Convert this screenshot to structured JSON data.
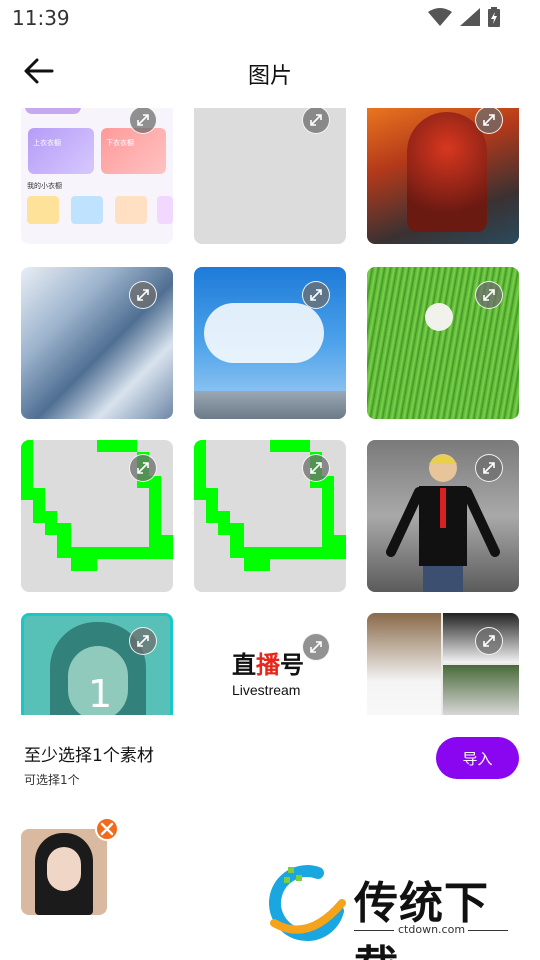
{
  "status": {
    "time": "11:39"
  },
  "header": {
    "title": "图片"
  },
  "grid": {
    "tiles": [
      {
        "name": "tile-app-screenshot",
        "overlay_text": "",
        "top_tag_a": "上衣衣橱",
        "top_tag_b": "下衣衣橱",
        "section": "我的小衣橱"
      },
      {
        "name": "tile-blank",
        "overlay_text": ""
      },
      {
        "name": "tile-armored-soldier",
        "overlay_text": ""
      },
      {
        "name": "tile-glacier",
        "overlay_text": ""
      },
      {
        "name": "tile-blue-sky",
        "overlay_text": ""
      },
      {
        "name": "tile-green-grass",
        "overlay_text": ""
      },
      {
        "name": "tile-pixel-shape-1",
        "overlay_text": ""
      },
      {
        "name": "tile-pixel-shape-2",
        "overlay_text": ""
      },
      {
        "name": "tile-cartoon-figure",
        "overlay_text": ""
      },
      {
        "name": "tile-portrait-selected",
        "overlay_text": "1"
      },
      {
        "name": "tile-livestream-logo",
        "logo_cn_1": "直",
        "logo_cn_2": "播",
        "logo_cn_3": "号",
        "logo_en": "Livestream"
      },
      {
        "name": "tile-photo-collage",
        "overlay_text": ""
      }
    ]
  },
  "panel": {
    "min_select": "至少选择1个素材",
    "can_select": "可选择1个",
    "import_label": "导入"
  },
  "watermark": {
    "brand": "传统下载",
    "url": "ctdown.com"
  },
  "colors": {
    "accent": "#8b06f0",
    "remove": "#f26a1b",
    "selected_border": "#19c7c9",
    "pixel_green": "#00ff00"
  }
}
